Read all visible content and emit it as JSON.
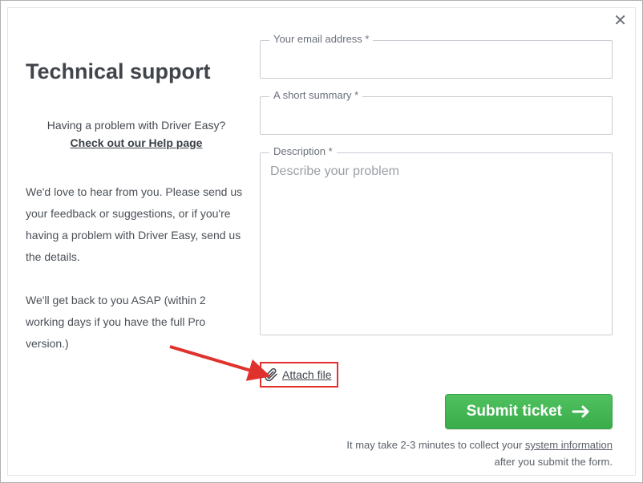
{
  "title": "Technical support",
  "subtitle": "Having a problem with Driver Easy?",
  "help_link": "Check out our Help page",
  "para1": "We'd love to hear from you. Please send us your feedback or suggestions, or if you're having a problem with Driver Easy, send us the details.",
  "para2": "We'll get back to you ASAP (within 2 working days if you have the full Pro version.)",
  "fields": {
    "email": {
      "label": "Your email address *",
      "value": ""
    },
    "summary": {
      "label": "A short summary *",
      "value": ""
    },
    "description": {
      "label": "Description *",
      "placeholder": "Describe your problem",
      "value": ""
    }
  },
  "attach_label": "Attach file",
  "submit_label": "Submit ticket",
  "footnote_pre": "It may take 2-3 minutes to collect your ",
  "footnote_link": "system information",
  "footnote_post": "after you submit the form.",
  "close_glyph": "✕"
}
